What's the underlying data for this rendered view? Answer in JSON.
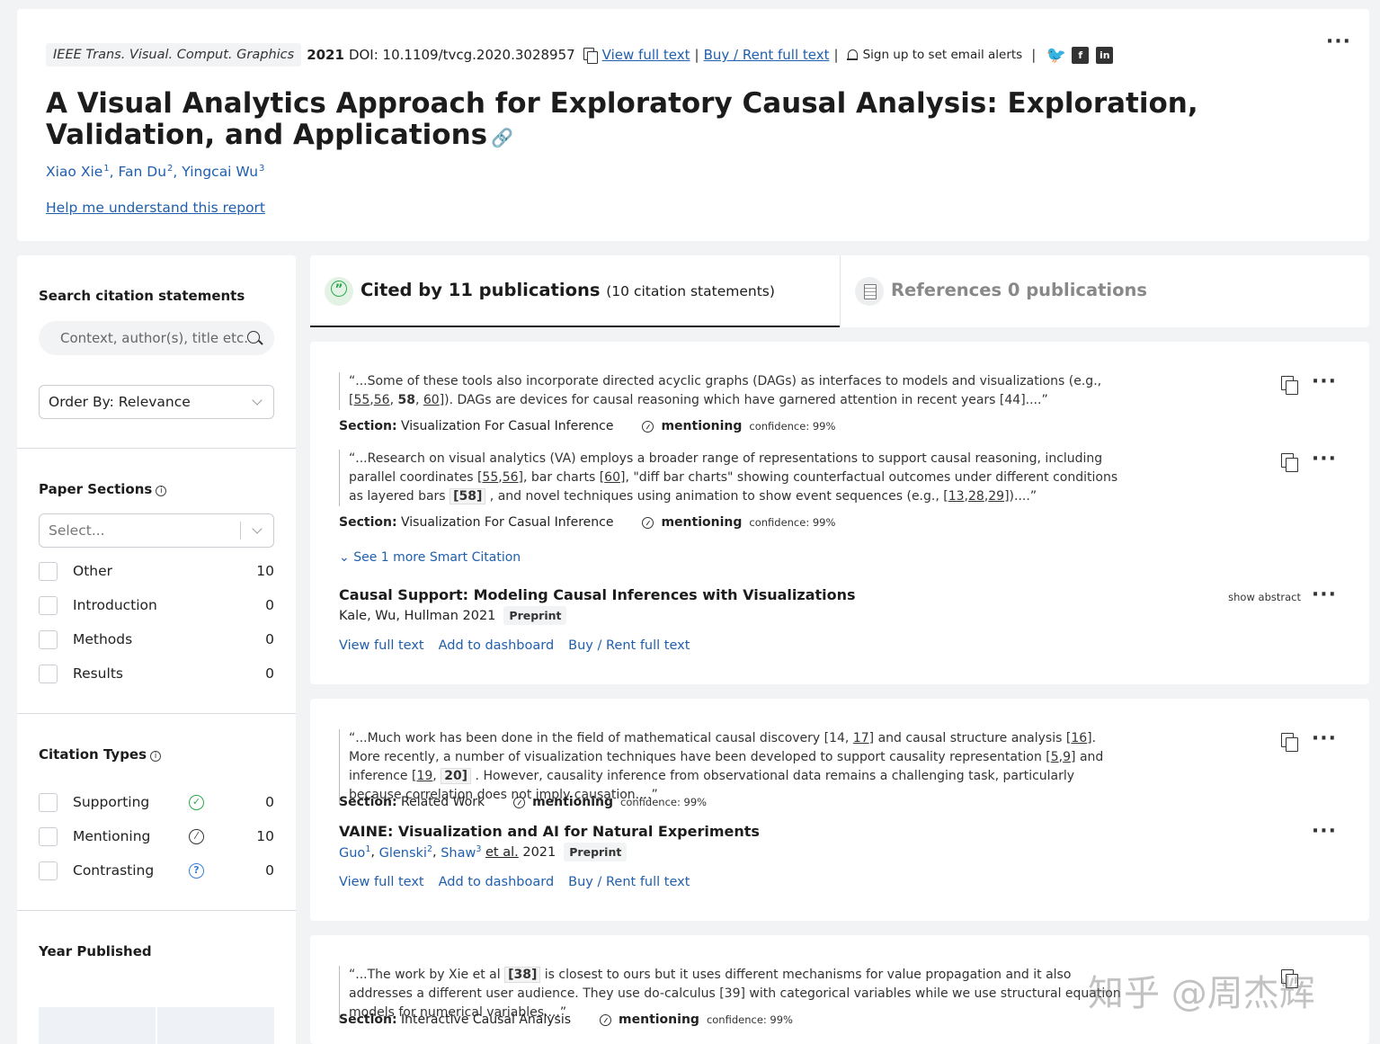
{
  "header": {
    "journal": "IEEE Trans. Visual. Comput. Graphics",
    "year": "2021",
    "doi": "DOI: 10.1109/tvcg.2020.3028957",
    "view_full_text": "View full text",
    "buy_rent": "Buy / Rent full text",
    "alerts": "Sign up to set email alerts",
    "title": "A Visual Analytics Approach for Exploratory Causal Analysis: Exploration, Validation, and Applications",
    "authors": [
      {
        "name": "Xiao Xie",
        "sup": "1"
      },
      {
        "name": "Fan Du",
        "sup": "2"
      },
      {
        "name": "Yingcai Wu",
        "sup": "3"
      }
    ],
    "help_link": "Help me understand this report"
  },
  "sidebar": {
    "search_heading": "Search citation statements",
    "search_placeholder": "Context, author(s), title etc.",
    "order_by": "Order By: Relevance",
    "sections_heading": "Paper Sections",
    "sections_placeholder": "Select...",
    "sections": [
      {
        "label": "Other",
        "count": "10"
      },
      {
        "label": "Introduction",
        "count": "0"
      },
      {
        "label": "Methods",
        "count": "0"
      },
      {
        "label": "Results",
        "count": "0"
      }
    ],
    "types_heading": "Citation Types",
    "types": [
      {
        "label": "Supporting",
        "count": "0",
        "icon": "check-circle-icon"
      },
      {
        "label": "Mentioning",
        "count": "10",
        "icon": "mentioning-icon"
      },
      {
        "label": "Contrasting",
        "count": "0",
        "icon": "question-circle-icon"
      }
    ],
    "year_heading": "Year Published"
  },
  "tabs": {
    "cited_by": "Cited by 11 publications",
    "cited_by_sub": "(10 citation statements)",
    "references": "References 0 publications"
  },
  "cards": [
    {
      "citations": [
        {
          "section_label": "Section:",
          "section": "Visualization For Casual Inference",
          "type": "mentioning",
          "confidence": "confidence: 99%"
        },
        {
          "section_label": "Section:",
          "section": "Visualization For Casual Inference",
          "type": "mentioning",
          "confidence": "confidence: 99%"
        }
      ],
      "see_more": "See 1 more Smart Citation",
      "paper_title": "Causal Support: Modeling Causal Inferences with Visualizations",
      "paper_authors": "Kale, Wu, Hullman 2021",
      "badge": "Preprint",
      "show_abstract": "show abstract",
      "actions": [
        "View full text",
        "Add to dashboard",
        "Buy / Rent full text"
      ]
    },
    {
      "citations": [
        {
          "section_label": "Section:",
          "section": "Related Work",
          "type": "mentioning",
          "confidence": "confidence: 99%"
        }
      ],
      "paper_title": "VAINE: Visualization and AI for Natural Experiments",
      "paper_authors": [
        {
          "name": "Guo",
          "sup": "1"
        },
        {
          "name": "Glenski",
          "sup": "2"
        },
        {
          "name": "Shaw",
          "sup": "3"
        }
      ],
      "et_al": "et al.",
      "year": "2021",
      "badge": "Preprint",
      "actions": [
        "View full text",
        "Add to dashboard",
        "Buy / Rent full text"
      ]
    },
    {
      "citations": [
        {
          "section_label": "Section:",
          "section": "Interactive Causal Analysis",
          "type": "mentioning",
          "confidence": "confidence: 99%"
        }
      ]
    }
  ],
  "watermark": "知乎 @周杰辉"
}
